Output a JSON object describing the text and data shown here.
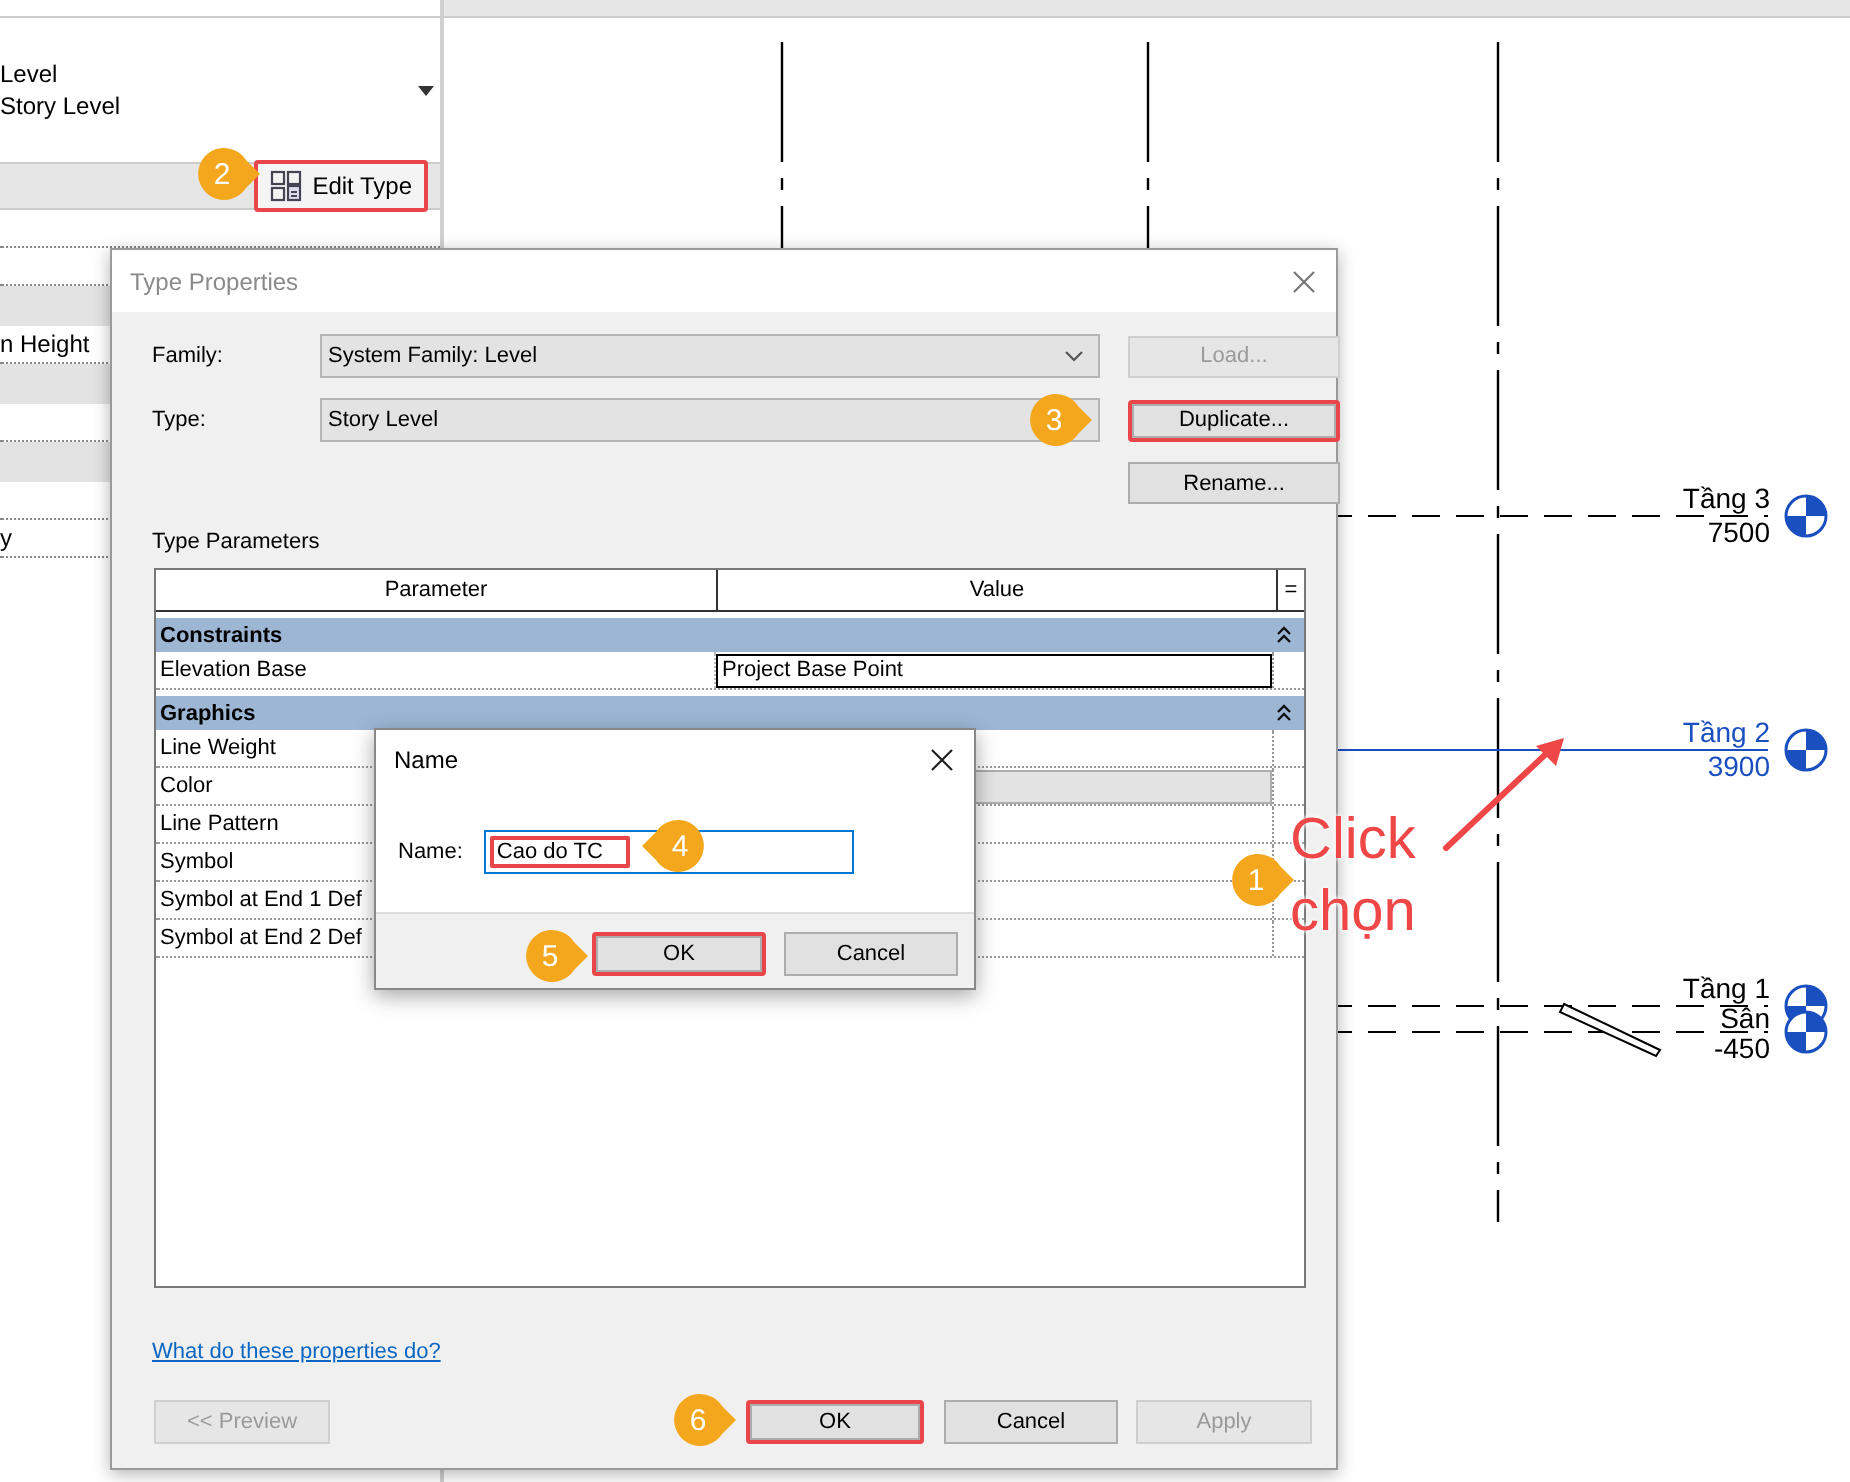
{
  "properties_panel": {
    "type_lines": [
      "Level",
      "Story Level"
    ],
    "edit_type_button": {
      "label": "Edit Type",
      "highlighted": true
    },
    "row_labels": [
      "n Height",
      "y"
    ]
  },
  "canvas": {
    "levels": [
      {
        "name": "Tầng 3",
        "elevation": "7500",
        "selected": false
      },
      {
        "name": "Tầng 2",
        "elevation": "3900",
        "selected": true
      },
      {
        "name": "Tầng 1",
        "selected": false
      },
      {
        "name": "Sân",
        "elevation": "-450",
        "selected": false
      }
    ]
  },
  "type_properties": {
    "title": "Type Properties",
    "family_label": "Family:",
    "family_value": "System Family: Level",
    "type_label": "Type:",
    "type_value": "Story Level",
    "side_buttons": [
      {
        "label": "Load...",
        "disabled": true,
        "highlighted": false
      },
      {
        "label": "Duplicate...",
        "disabled": false,
        "highlighted": true
      },
      {
        "label": "Rename...",
        "disabled": false,
        "highlighted": false
      }
    ],
    "section_label": "Type Parameters",
    "table": {
      "columns": [
        "Parameter",
        "Value",
        "="
      ],
      "rows": [
        {
          "kind": "group",
          "name": "Constraints"
        },
        {
          "kind": "param",
          "name": "Elevation Base",
          "value": {
            "kind": "field",
            "text": "Project Base Point"
          }
        },
        {
          "kind": "group",
          "name": "Graphics"
        },
        {
          "kind": "param",
          "name": "Line Weight"
        },
        {
          "kind": "param",
          "name": "Color",
          "value": {
            "kind": "button"
          }
        },
        {
          "kind": "param",
          "name": "Line Pattern"
        },
        {
          "kind": "param",
          "name": "Symbol"
        },
        {
          "kind": "param",
          "name": "Symbol at End 1 Def"
        },
        {
          "kind": "param",
          "name": "Symbol at End 2 Def"
        }
      ]
    },
    "help_link": "What do these properties do?",
    "buttons": [
      {
        "label": "<< Preview",
        "disabled": true,
        "highlighted": false
      },
      {
        "label": "OK",
        "disabled": false,
        "highlighted": true
      },
      {
        "label": "Cancel",
        "disabled": false,
        "highlighted": false
      },
      {
        "label": "Apply",
        "disabled": true,
        "highlighted": false
      }
    ]
  },
  "name_dialog": {
    "title": "Name",
    "field_label": "Name:",
    "field_value": "Cao do TC",
    "field_highlighted": true,
    "buttons": [
      {
        "label": "OK",
        "highlighted": true
      },
      {
        "label": "Cancel",
        "highlighted": false
      }
    ]
  },
  "annotations": {
    "steps": [
      "1",
      "2",
      "3",
      "4",
      "5",
      "6"
    ],
    "callout": "Click chọn"
  }
}
